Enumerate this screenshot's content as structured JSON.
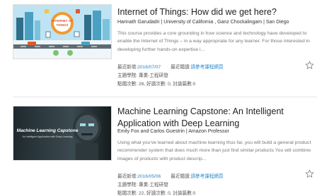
{
  "courses": [
    {
      "title": "Internet of Things: How did we get here?",
      "authors": "Harinath Garudadri | University of California , Ganz Chockalingam | San Diego",
      "description": "This course provides a core grounding in how science and technology have developed to enable the Internet of Things – in a way appropriate for any learner. For those interested in developing further hands-on expertise i...",
      "updated_label": "最近新增:",
      "updated_value": "2016/07/07",
      "read_label": "最近閱讀:",
      "read_link": "請參考課程網頁",
      "school": "主題學院: 專業-工程研發",
      "stats": "點閱次數: 26, 好讀次數: 0, 討論篇數:0",
      "thumbnail": {
        "text": "INTERNET OF THINGS"
      }
    },
    {
      "title": "Machine Learning Capstone: An Intelligent Application with Deep Learning",
      "authors": "Emily Fox and Carlos Guestrin | Amazon Professor",
      "description": "Using what you've learned about machine learning thus far, you will build a general product recommender system that does much more than just find similar products You will combine images of products with product descrip...",
      "updated_label": "最近新增:",
      "updated_value": "2016/05/06",
      "read_label": "最近閱讀:",
      "read_link": "請參考課程網頁",
      "school": "主題學院: 專業-工程研發",
      "stats": "點閱次數: 22, 好讀次數: 0, 討論篇數:0",
      "thumbnail": {
        "title": "Machine Learning Capstone",
        "subtitle": "An Intelligent Application with Deep Learning"
      }
    }
  ],
  "colors": {
    "link": "#2a86c9",
    "title": "#222222",
    "description": "#777777",
    "divider": "#e4e4e4"
  },
  "icons": {
    "favorite": "star-outline-icon"
  }
}
